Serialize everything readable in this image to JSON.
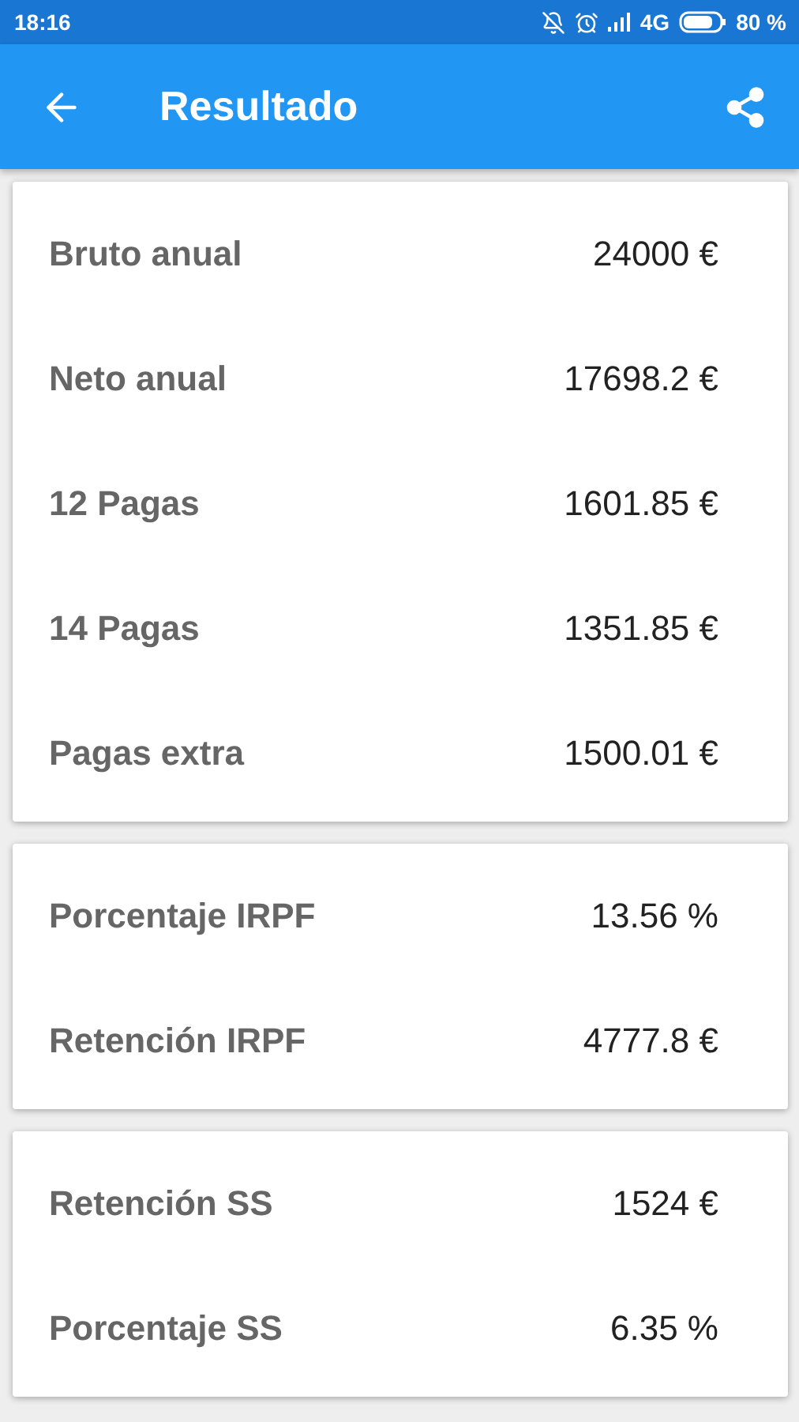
{
  "status_bar": {
    "time": "18:16",
    "network": "4G",
    "battery": "80 %"
  },
  "app_bar": {
    "title": "Resultado"
  },
  "cards": [
    {
      "rows": [
        {
          "label": "Bruto anual",
          "value": "24000 €"
        },
        {
          "label": "Neto anual",
          "value": "17698.2 €"
        },
        {
          "label": "12 Pagas",
          "value": "1601.85 €"
        },
        {
          "label": "14 Pagas",
          "value": "1351.85 €"
        },
        {
          "label": "Pagas extra",
          "value": "1500.01 €"
        }
      ]
    },
    {
      "rows": [
        {
          "label": "Porcentaje IRPF",
          "value": "13.56 %"
        },
        {
          "label": "Retención IRPF",
          "value": "4777.8 €"
        }
      ]
    },
    {
      "rows": [
        {
          "label": "Retención SS",
          "value": "1524 €"
        },
        {
          "label": "Porcentaje SS",
          "value": "6.35 %"
        }
      ]
    }
  ]
}
